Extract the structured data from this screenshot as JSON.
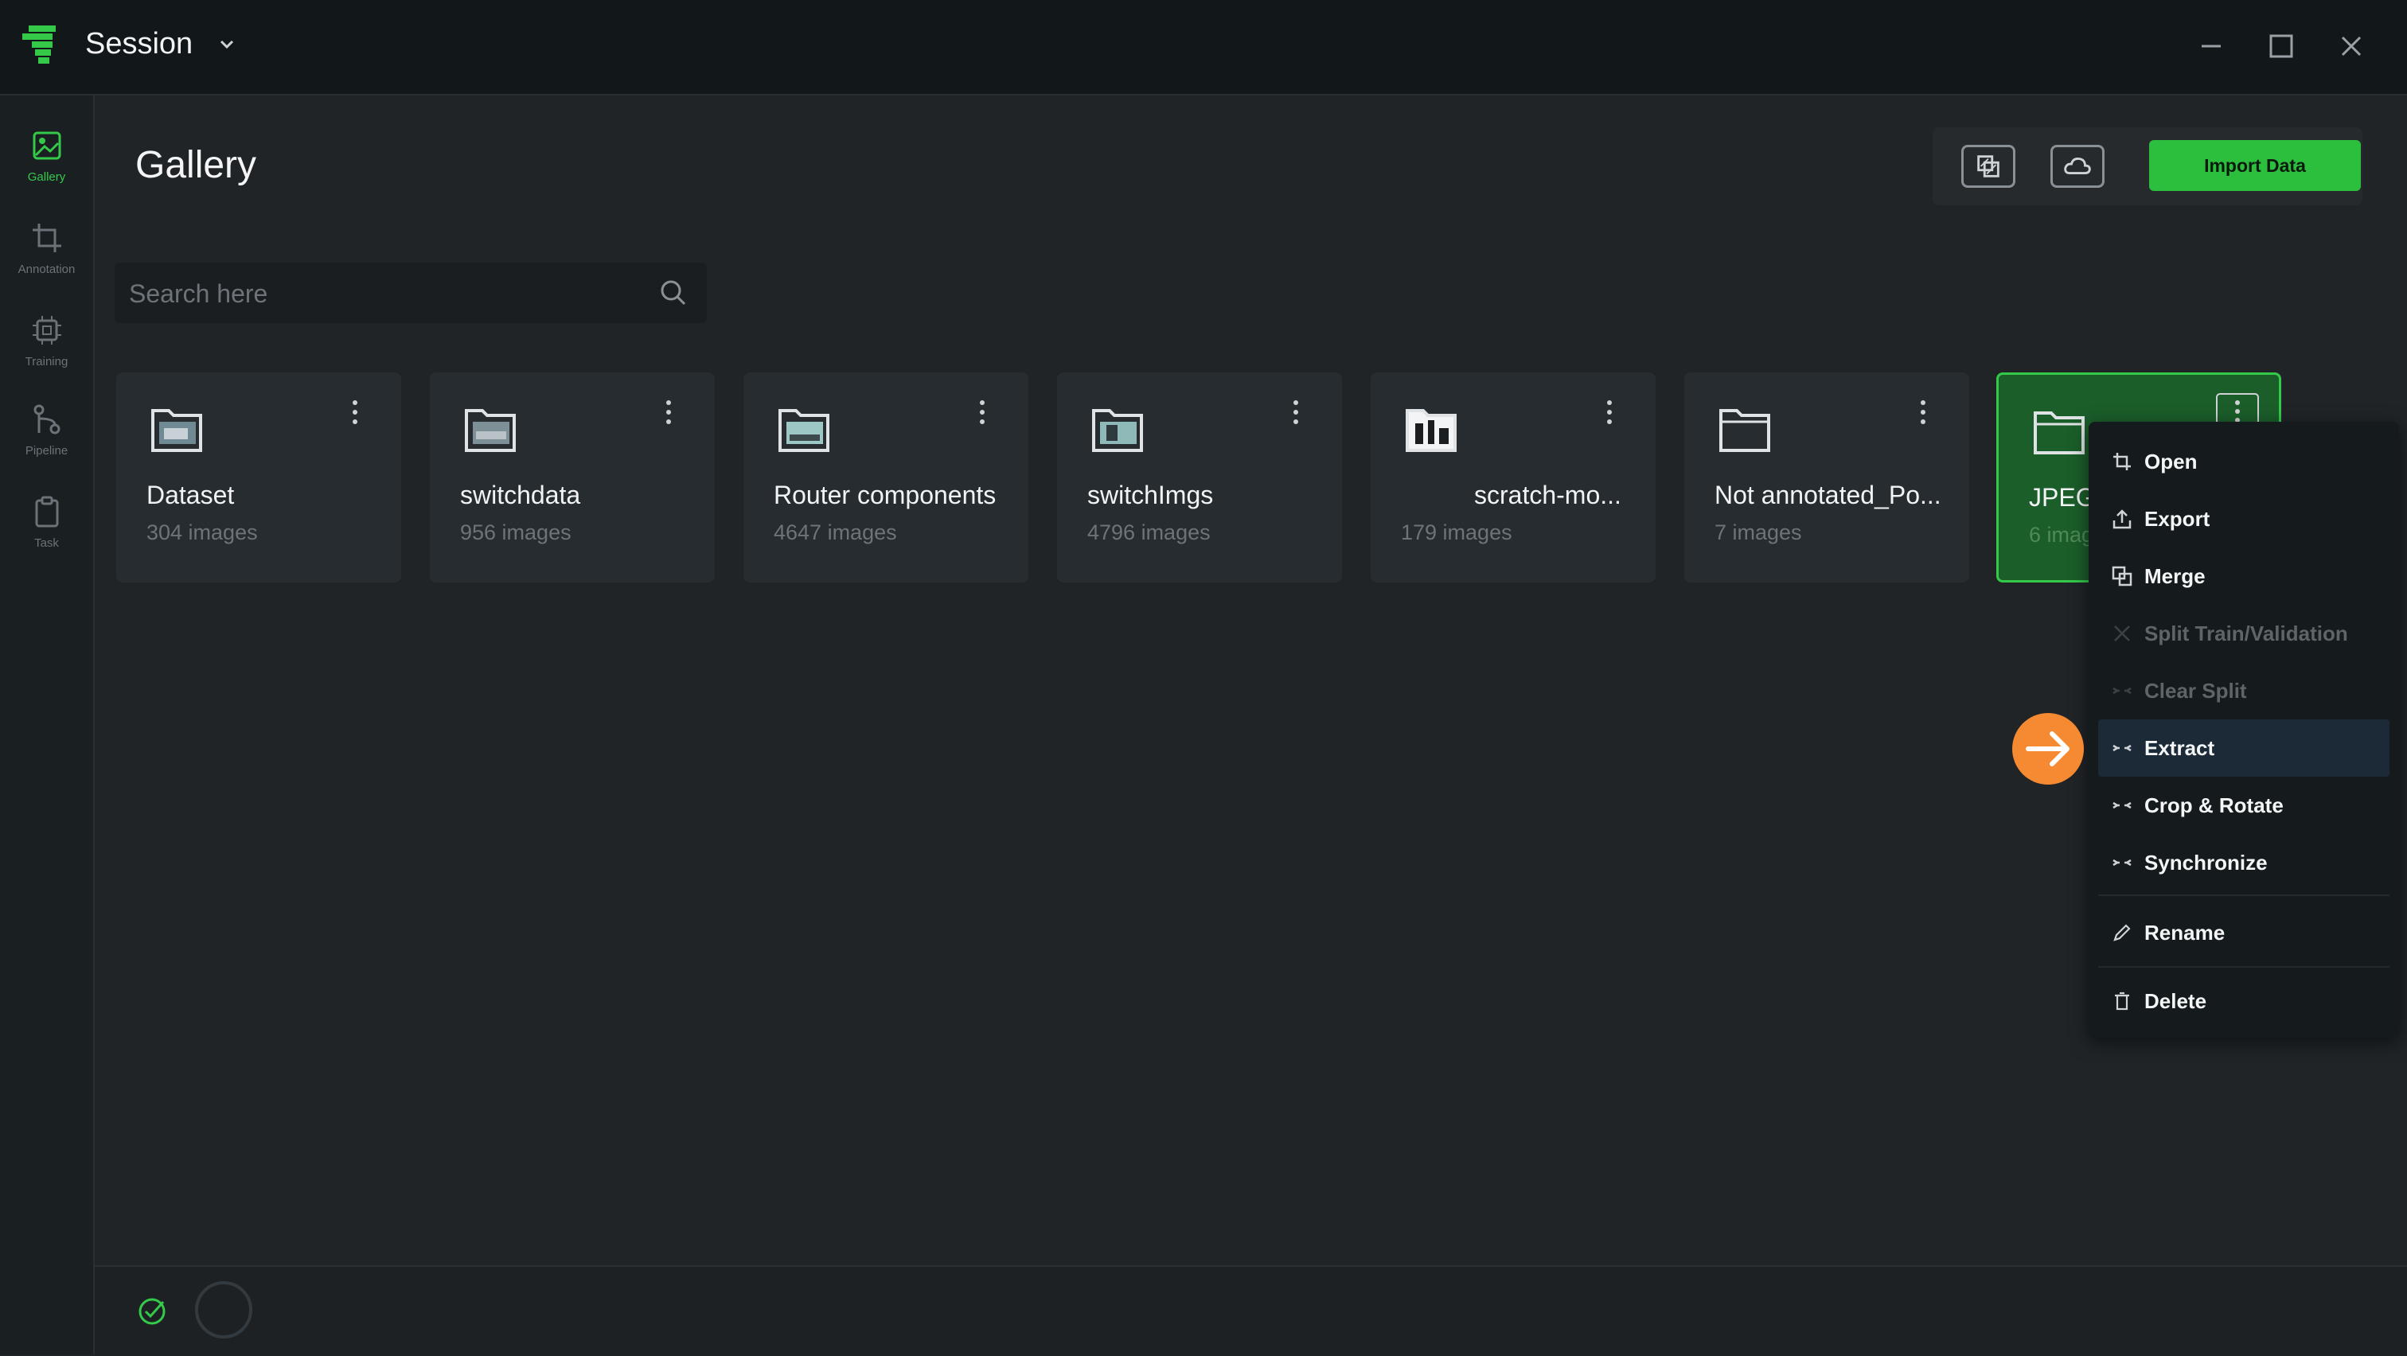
{
  "titlebar": {
    "app_name": "Session",
    "logo_icon": "app-logo-icon"
  },
  "sidebar": {
    "items": [
      {
        "label": "Gallery",
        "icon": "gallery-icon",
        "active": true
      },
      {
        "label": "Annotation",
        "icon": "crop-icon",
        "active": false
      },
      {
        "label": "Training",
        "icon": "chip-icon",
        "active": false
      },
      {
        "label": "Pipeline",
        "icon": "pipeline-icon",
        "active": false
      },
      {
        "label": "Task",
        "icon": "clipboard-icon",
        "active": false
      }
    ]
  },
  "header": {
    "title": "Gallery",
    "import_label": "Import Data"
  },
  "search": {
    "placeholder": "Search here"
  },
  "folders": [
    {
      "name": "Dataset",
      "count": "304 images"
    },
    {
      "name": "switchdata",
      "count": "956 images"
    },
    {
      "name": "Router components",
      "count": "4647 images"
    },
    {
      "name": "switchImgs",
      "count": "4796 images"
    },
    {
      "name": "scratch-mo...",
      "count": "179 images"
    },
    {
      "name": "Not annotated_Po...",
      "count": "7 images"
    },
    {
      "name": "JPEG",
      "count": "6 imag"
    }
  ],
  "context_menu": {
    "items": [
      {
        "label": "Open",
        "icon": "crop-icon",
        "enabled": true
      },
      {
        "label": "Export",
        "icon": "upload-icon",
        "enabled": true
      },
      {
        "label": "Merge",
        "icon": "merge-icon",
        "enabled": true
      },
      {
        "label": "Split Train/Validation",
        "icon": "split-icon",
        "enabled": false
      },
      {
        "label": "Clear Split",
        "icon": "arrows-icon",
        "enabled": false
      },
      {
        "label": "Extract",
        "icon": "arrows-icon",
        "enabled": true
      },
      {
        "label": "Crop & Rotate",
        "icon": "arrows-icon",
        "enabled": true
      },
      {
        "label": "Synchronize",
        "icon": "arrows-icon",
        "enabled": true
      },
      {
        "label": "Rename",
        "icon": "pencil-icon",
        "enabled": true
      },
      {
        "label": "Delete",
        "icon": "trash-icon",
        "enabled": true
      }
    ]
  },
  "colors": {
    "accent": "#2bbf3d",
    "pointer": "#f58a32",
    "background": "#202427"
  }
}
